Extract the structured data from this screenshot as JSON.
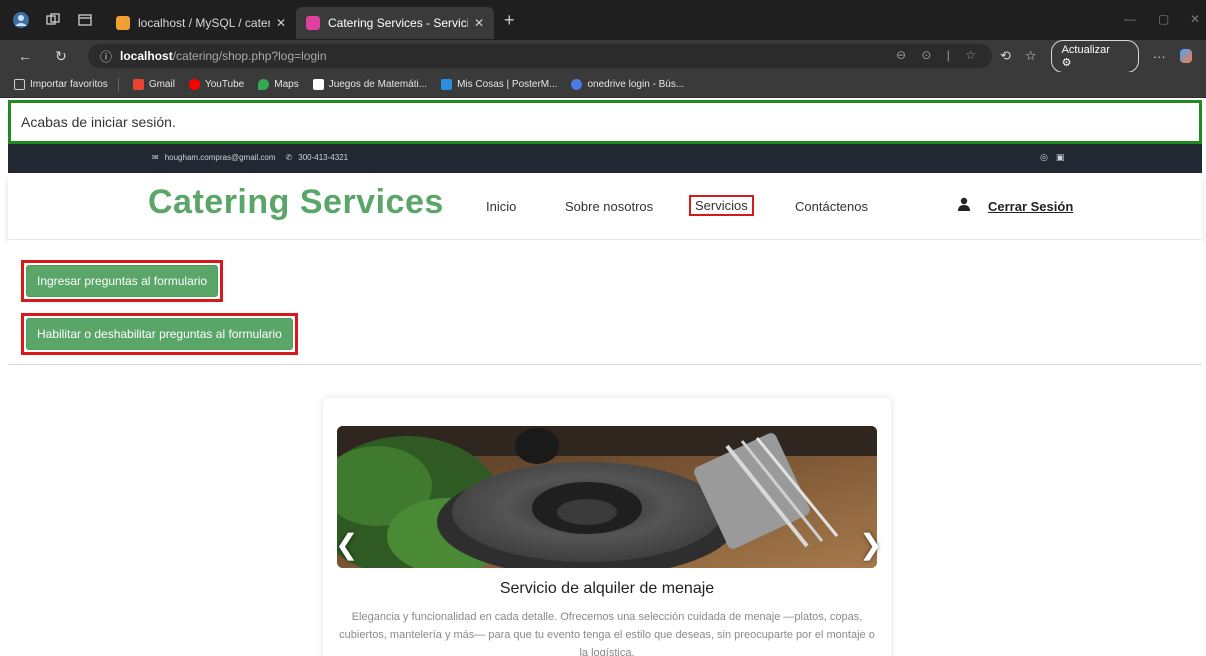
{
  "browser": {
    "tabs": [
      {
        "title": "localhost / MySQL / cateringdb /",
        "active": false,
        "favicon_color": "#f0a030"
      },
      {
        "title": "Catering Services - Servicios",
        "active": true,
        "favicon_color": "#e040a0"
      }
    ],
    "url_host": "localhost",
    "url_path": "/catering/shop.php?log=login",
    "update_label": "Actualizar",
    "bookmarks": [
      {
        "label": "Importar favoritos",
        "icon_color": "#cfcfcf"
      },
      {
        "label": "Gmail",
        "icon_color": "#ea4335"
      },
      {
        "label": "YouTube",
        "icon_color": "#ff0000"
      },
      {
        "label": "Maps",
        "icon_color": "#34a853"
      },
      {
        "label": "Juegos de Matemáti...",
        "icon_color": "#ffffff"
      },
      {
        "label": "Mis Cosas | PosterM...",
        "icon_color": "#2a8fe0"
      },
      {
        "label": "onedrive login - Bús...",
        "icon_color": "#4a7be0"
      }
    ]
  },
  "alert": {
    "message": "Acabas de iniciar sesión."
  },
  "topbar": {
    "email": "hougham.compras@gmail.com",
    "phone": "300-413-4321"
  },
  "header": {
    "brand": "Catering Services",
    "nav": [
      {
        "label": "Inicio",
        "active": false
      },
      {
        "label": "Sobre nosotros",
        "active": false
      },
      {
        "label": "Servicios",
        "active": true
      },
      {
        "label": "Contáctenos",
        "active": false
      }
    ],
    "logout_label": "Cerrar Sesión"
  },
  "actions": {
    "add_questions_label": "Ingresar preguntas al formulario",
    "toggle_questions_label": "Habilitar o deshabilitar preguntas al formulario"
  },
  "service_card": {
    "title": "Servicio de alquiler de menaje",
    "description": "Elegancia y funcionalidad en cada detalle. Ofrecemos una selección cuidada de menaje —platos, copas, cubiertos, mantelería y más— para que tu evento tenga el estilo que deseas, sin preocuparte por el montaje o la logística."
  },
  "colors": {
    "brand_green": "#5aa568",
    "highlight_red": "#d7191c",
    "alert_border": "#1f8a1f",
    "topbar_bg": "#222831"
  }
}
